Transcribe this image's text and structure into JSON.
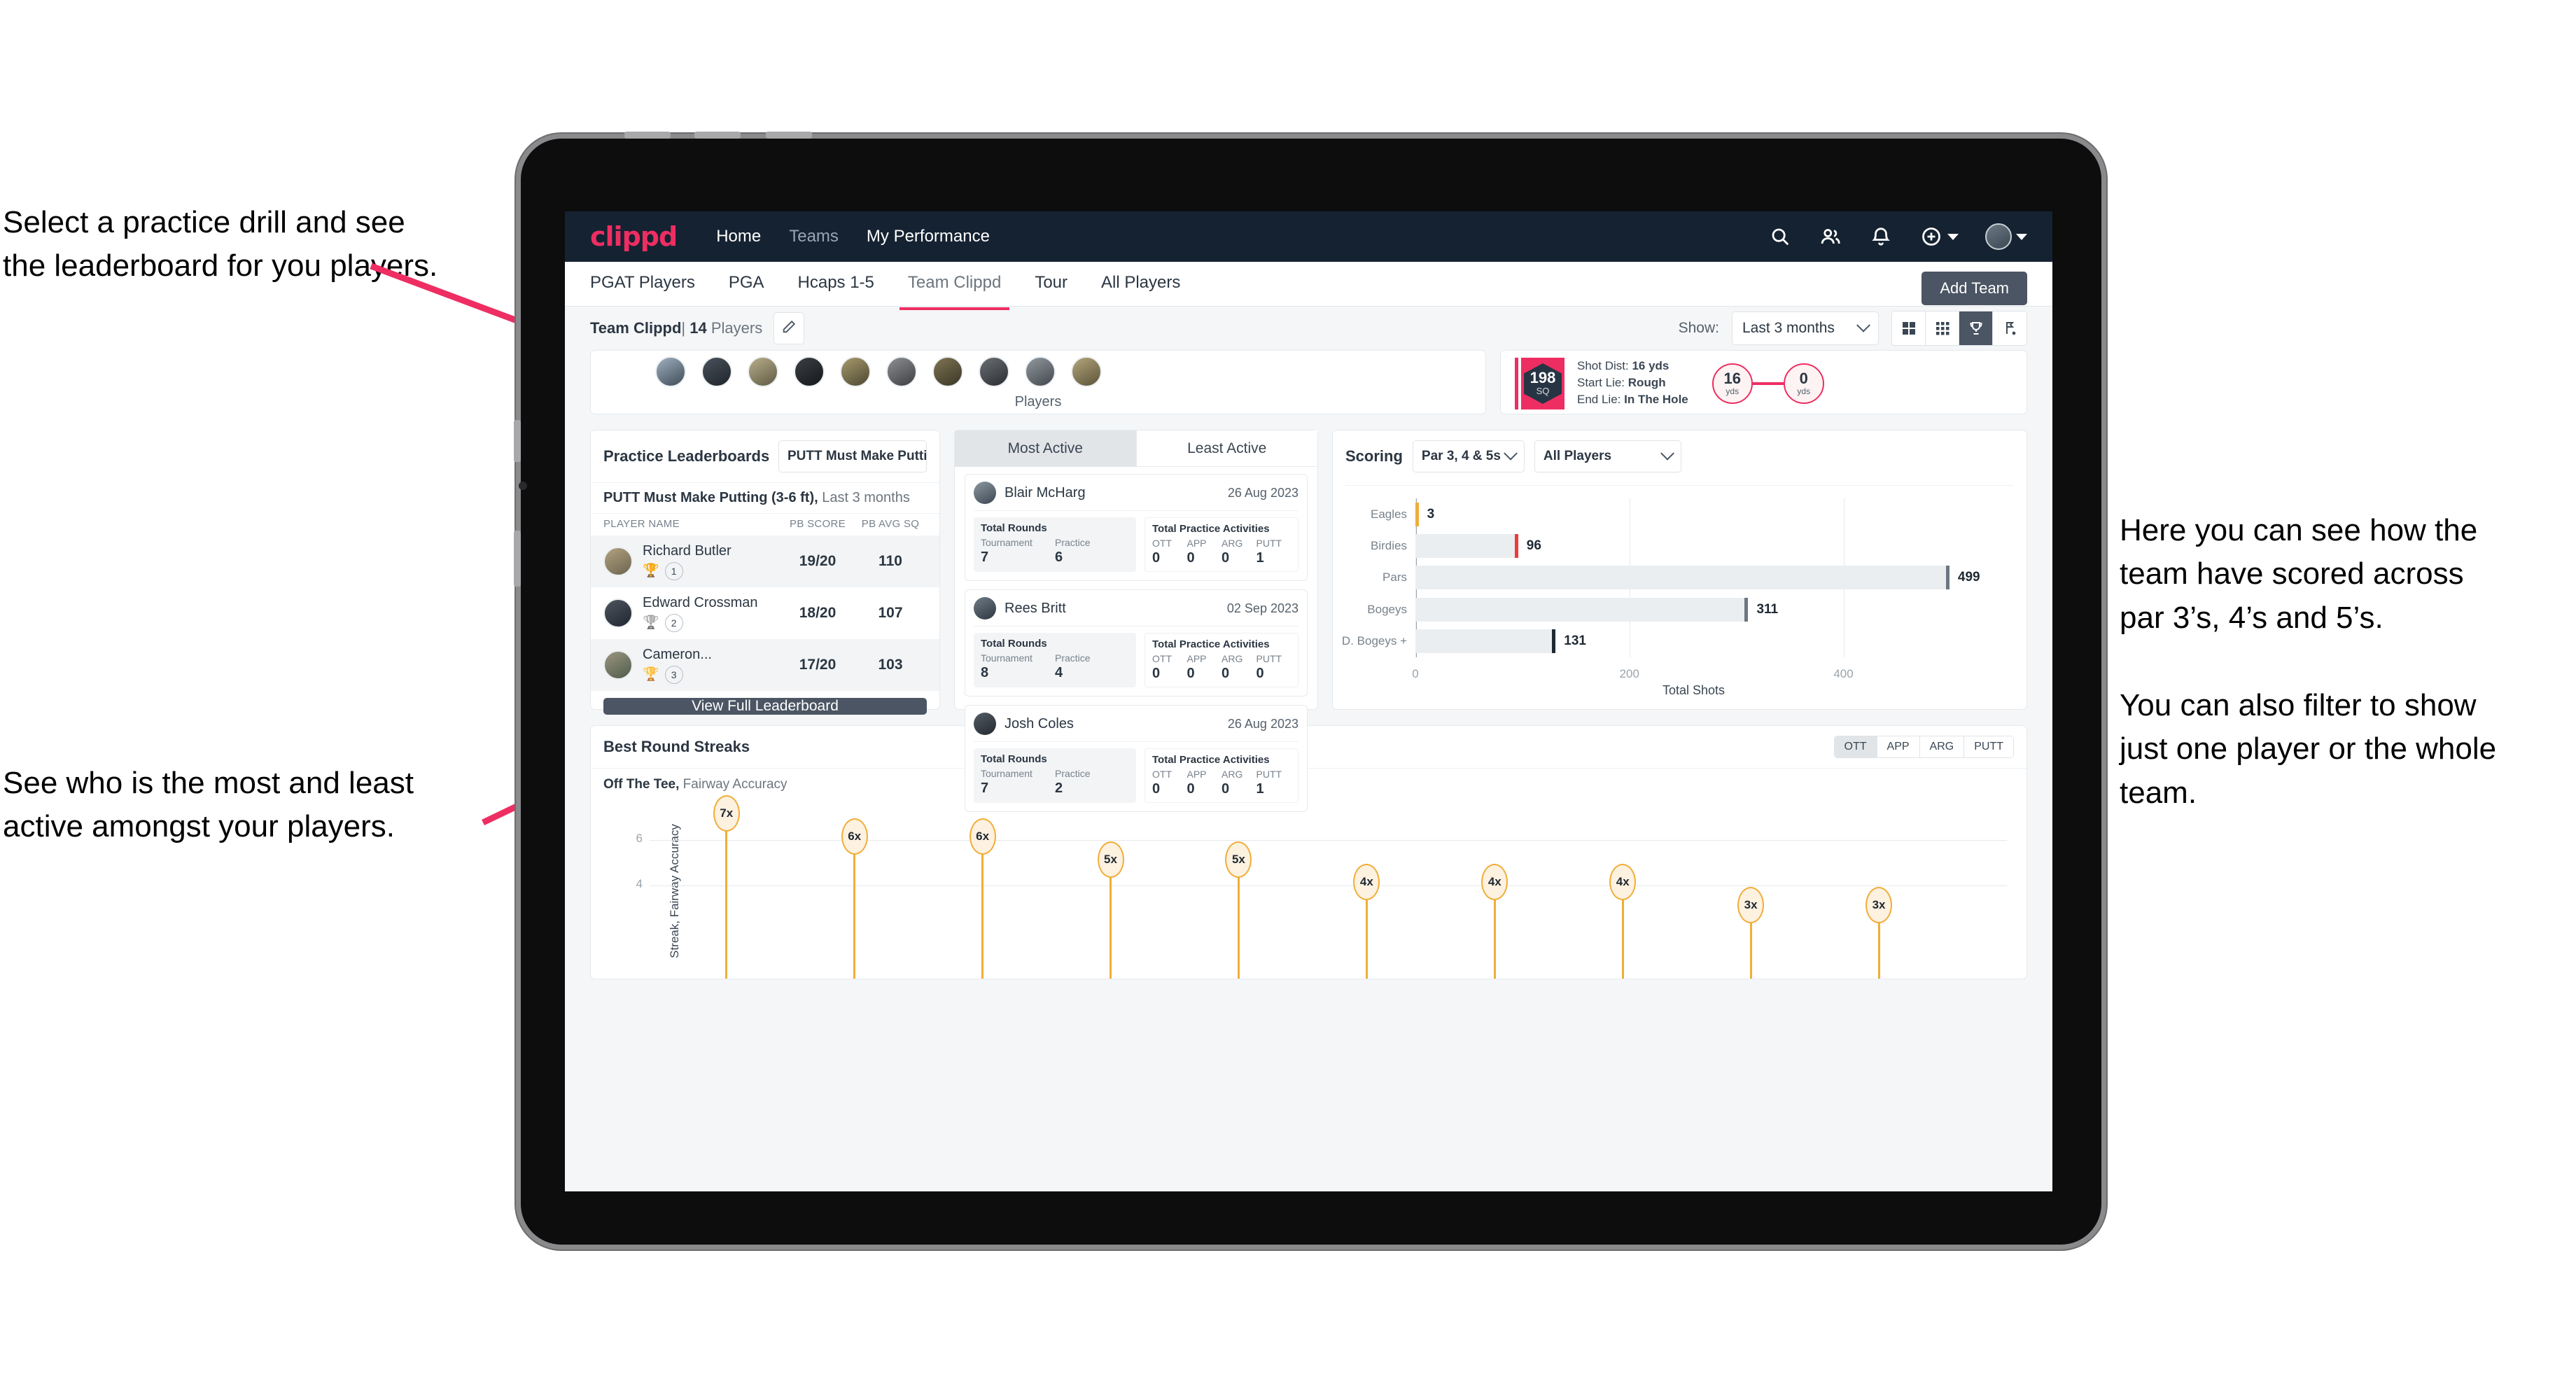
{
  "annotations": {
    "top_left": "Select a practice drill and see\nthe leaderboard for you players.",
    "bottom_left": "See who is the most and least\nactive amongst your players.",
    "right": "Here you can see how the\nteam have scored across\npar 3’s, 4’s and 5’s.\n\nYou can also filter to show\njust one player or the whole\nteam."
  },
  "colors": {
    "brand_pink": "#ee2e62",
    "navbar": "#152232",
    "dark_button": "#4b5563",
    "amber": "#efae3a"
  },
  "topnav": {
    "logo": "clippd",
    "links": [
      {
        "label": "Home",
        "dim": false
      },
      {
        "label": "Teams",
        "dim": true
      },
      {
        "label": "My Performance",
        "dim": false
      }
    ],
    "icons": [
      "search-icon",
      "people-icon",
      "bell-icon",
      "plus-circle-icon",
      "avatar"
    ]
  },
  "tabbar": {
    "tabs": [
      {
        "label": "PGAT Players",
        "active": false
      },
      {
        "label": "PGA",
        "active": false
      },
      {
        "label": "Hcaps 1-5",
        "active": false
      },
      {
        "label": "Team Clippd",
        "active": true
      },
      {
        "label": "Tour",
        "active": false
      },
      {
        "label": "All Players",
        "active": false
      }
    ],
    "add_team_label": "Add Team"
  },
  "subheader": {
    "team_name": "Team Clippd",
    "separator": "|",
    "player_count": "14",
    "players_word": "Players",
    "edit_icon": "pencil-icon",
    "show_label": "Show:",
    "range_value": "Last 3 months",
    "view_modes": [
      {
        "name": "grid-large-icon",
        "active": false
      },
      {
        "name": "grid-small-icon",
        "active": false
      },
      {
        "name": "trophy-icon",
        "active": true
      },
      {
        "name": "golf-flag-icon",
        "active": false
      }
    ]
  },
  "players_strip": {
    "label": "Players",
    "avatar_count": 10
  },
  "shot_card": {
    "sq_value": "198",
    "sq_unit": "SQ",
    "lines": [
      {
        "key": "Shot Dist:",
        "value": "16 yds"
      },
      {
        "key": "Start Lie:",
        "value": "Rough"
      },
      {
        "key": "End Lie:",
        "value": "In The Hole"
      }
    ],
    "dials": [
      {
        "value": "16",
        "unit": "yds"
      },
      {
        "value": "0",
        "unit": "yds"
      }
    ]
  },
  "leaderboard": {
    "title": "Practice Leaderboards",
    "drill_select": "PUTT Must Make Putting ...",
    "subtitle_bold": "PUTT Must Make Putting (3-6 ft),",
    "subtitle_muted": "Last 3 months",
    "columns": [
      "PLAYER NAME",
      "PB SCORE",
      "PB AVG SQ"
    ],
    "rows": [
      {
        "name": "Richard Butler",
        "trophy": "🏆",
        "rank": "1",
        "pb_score": "19/20",
        "pb_avg_sq": "110"
      },
      {
        "name": "Edward Crossman",
        "trophy": "🏆",
        "rank": "2",
        "pb_score": "18/20",
        "pb_avg_sq": "107"
      },
      {
        "name": "Cameron...",
        "trophy": "🏆",
        "rank": "3",
        "pb_score": "17/20",
        "pb_avg_sq": "103"
      }
    ],
    "button_label": "View Full Leaderboard"
  },
  "activity": {
    "tabs": [
      {
        "label": "Most Active",
        "active": true
      },
      {
        "label": "Least Active",
        "active": false
      }
    ],
    "rounds_title": "Total Rounds",
    "rounds_keys": [
      "Tournament",
      "Practice"
    ],
    "acts_title": "Total Practice Activities",
    "acts_keys": [
      "OTT",
      "APP",
      "ARG",
      "PUTT"
    ],
    "cards": [
      {
        "name": "Blair McHarg",
        "date": "26 Aug 2023",
        "rounds": [
          "7",
          "6"
        ],
        "acts": [
          "0",
          "0",
          "0",
          "1"
        ]
      },
      {
        "name": "Rees Britt",
        "date": "02 Sep 2023",
        "rounds": [
          "8",
          "4"
        ],
        "acts": [
          "0",
          "0",
          "0",
          "0"
        ]
      },
      {
        "name": "Josh Coles",
        "date": "26 Aug 2023",
        "rounds": [
          "7",
          "2"
        ],
        "acts": [
          "0",
          "0",
          "0",
          "1"
        ]
      }
    ]
  },
  "scoring": {
    "title": "Scoring",
    "par_select": "Par 3, 4 & 5s",
    "player_select": "All Players"
  },
  "streaks": {
    "title": "Best Round Streaks",
    "toggle": [
      {
        "label": "OTT",
        "active": true
      },
      {
        "label": "APP",
        "active": false
      },
      {
        "label": "ARG",
        "active": false
      },
      {
        "label": "PUTT",
        "active": false
      }
    ],
    "sub_bold": "Off The Tee,",
    "sub_muted": "Fairway Accuracy"
  },
  "chart_data": [
    {
      "type": "bar",
      "orientation": "horizontal",
      "title": "Scoring",
      "categories": [
        "Eagles",
        "Birdies",
        "Pars",
        "Bogeys",
        "D. Bogeys +"
      ],
      "values": [
        3,
        96,
        499,
        311,
        131
      ],
      "cap_colors": [
        "#efae3a",
        "#ee3a3a",
        "#6b7680",
        "#6b7680",
        "#1f2933"
      ],
      "xlabel": "Total Shots",
      "ylabel": "",
      "xlim": [
        0,
        520
      ],
      "xticks": [
        0,
        200,
        400
      ],
      "grid": true,
      "legend": false
    },
    {
      "type": "scatter",
      "title": "Best Round Streaks",
      "subtitle": "Off The Tee, Fairway Accuracy",
      "ylabel": "Streak, Fairway Accuracy",
      "labels": [
        "7x",
        "6x",
        "6x",
        "5x",
        "5x",
        "4x",
        "4x",
        "4x",
        "3x",
        "3x"
      ],
      "values": [
        7,
        6,
        6,
        5,
        5,
        4,
        4,
        4,
        3,
        3
      ],
      "ylim": [
        0,
        7.6
      ],
      "yticks": [
        4,
        6
      ],
      "grid": true,
      "legend": false
    }
  ]
}
